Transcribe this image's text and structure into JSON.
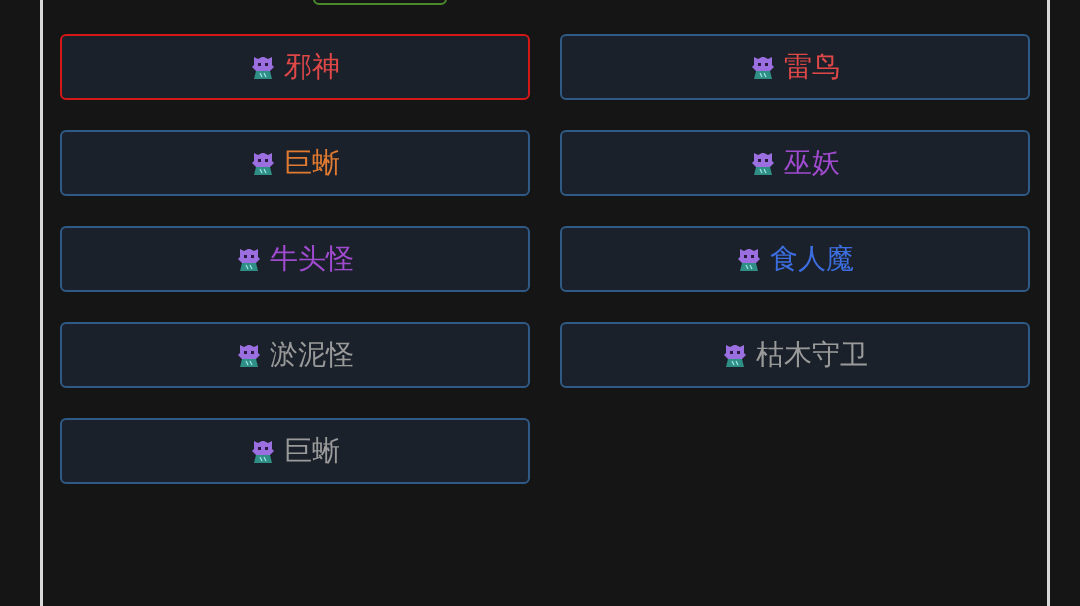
{
  "monsters": [
    {
      "name": "邪神",
      "color": "#e04848",
      "selected": true
    },
    {
      "name": "雷鸟",
      "color": "#e04848",
      "selected": false
    },
    {
      "name": "巨蜥",
      "color": "#e07a30",
      "selected": false
    },
    {
      "name": "巫妖",
      "color": "#a04ad0",
      "selected": false
    },
    {
      "name": "牛头怪",
      "color": "#a04ad0",
      "selected": false
    },
    {
      "name": "食人魔",
      "color": "#3c6ee0",
      "selected": false
    },
    {
      "name": "淤泥怪",
      "color": "#9a9a9a",
      "selected": false
    },
    {
      "name": "枯木守卫",
      "color": "#9a9a9a",
      "selected": false
    },
    {
      "name": "巨蜥",
      "color": "#9a9a9a",
      "selected": false
    }
  ]
}
